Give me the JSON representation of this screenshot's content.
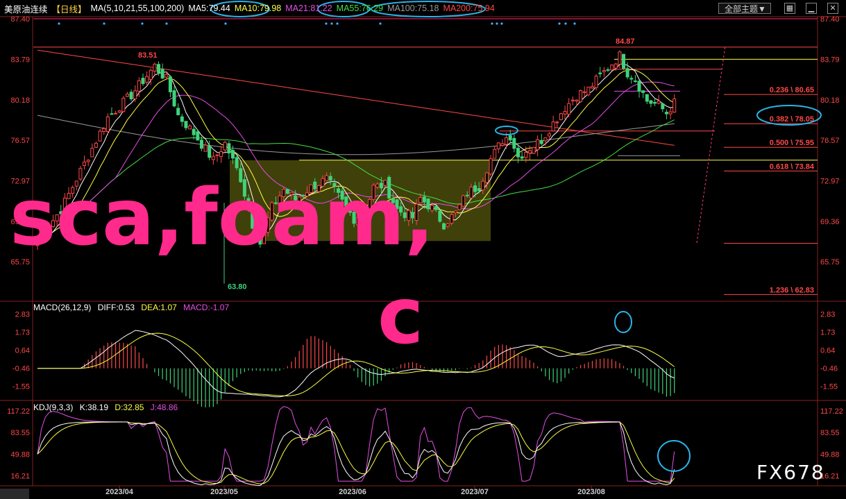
{
  "header": {
    "title": "美原油连续",
    "period": "【日线】",
    "ma_params": "MA(5,10,21,55,100,200)",
    "ma5": "MA5:79.44",
    "ma10": "MA10:79.98",
    "ma21": "MA21:81.22",
    "ma55": "MA55:76.29",
    "ma100": "MA100:75.18",
    "ma200": "MA200:75.94",
    "theme_button": "全部主题▼"
  },
  "colors": {
    "up": "#ff4848",
    "down": "#3fd27a",
    "ma5": "#ffffff",
    "ma10": "#ffff44",
    "ma21": "#e64fe6",
    "ma55": "#45e045",
    "ma100": "#9a9a9a",
    "ma200": "#ff4848",
    "fib_line": "#ff4848",
    "annotation": "#2ab4e8",
    "overlay_text": "#ff2a8c"
  },
  "icons": [
    "grid-icon",
    "minimize-icon",
    "close-icon"
  ],
  "chart_data": {
    "type": "candlestick",
    "price_axis": {
      "ticks": [
        "87.40",
        "83.79",
        "80.18",
        "76.57",
        "72.97",
        "69.36",
        "65.75"
      ]
    },
    "date_labels": [
      "2023/04",
      "2023/05",
      "2023/06",
      "2023/07",
      "2023/08"
    ],
    "price_labels": {
      "high": "83.51",
      "low": "63.80",
      "peak": "84.87"
    },
    "fib_levels": [
      {
        "ratio": "0.236",
        "value": "80.65"
      },
      {
        "ratio": "0.382",
        "value": "78.05"
      },
      {
        "ratio": "0.500",
        "value": "75.95"
      },
      {
        "ratio": "0.618",
        "value": "73.84"
      },
      {
        "ratio": "1.236",
        "value": "62.83"
      }
    ],
    "highlight_box": {
      "from": "2023/05",
      "to": "2023/07",
      "price_low": 67.6,
      "price_high": 74.8
    },
    "macd": {
      "params": "MACD(26,12,9)",
      "diff": "DIFF:0.53",
      "dea": "DEA:1.07",
      "macd": "MACD:-1.07",
      "axis_ticks": [
        "2.83",
        "1.73",
        "0.64",
        "-0.46",
        "-1.55"
      ]
    },
    "kdj": {
      "params": "KDJ(9,3,3)",
      "k": "K:38.19",
      "d": "D:32.85",
      "j": "J:48.86",
      "axis_ticks": [
        "117.22",
        "83.55",
        "49.88",
        "16.21"
      ]
    }
  },
  "overlay": {
    "line1": "sca,foam,",
    "line2": "c"
  },
  "watermark": "FX678"
}
